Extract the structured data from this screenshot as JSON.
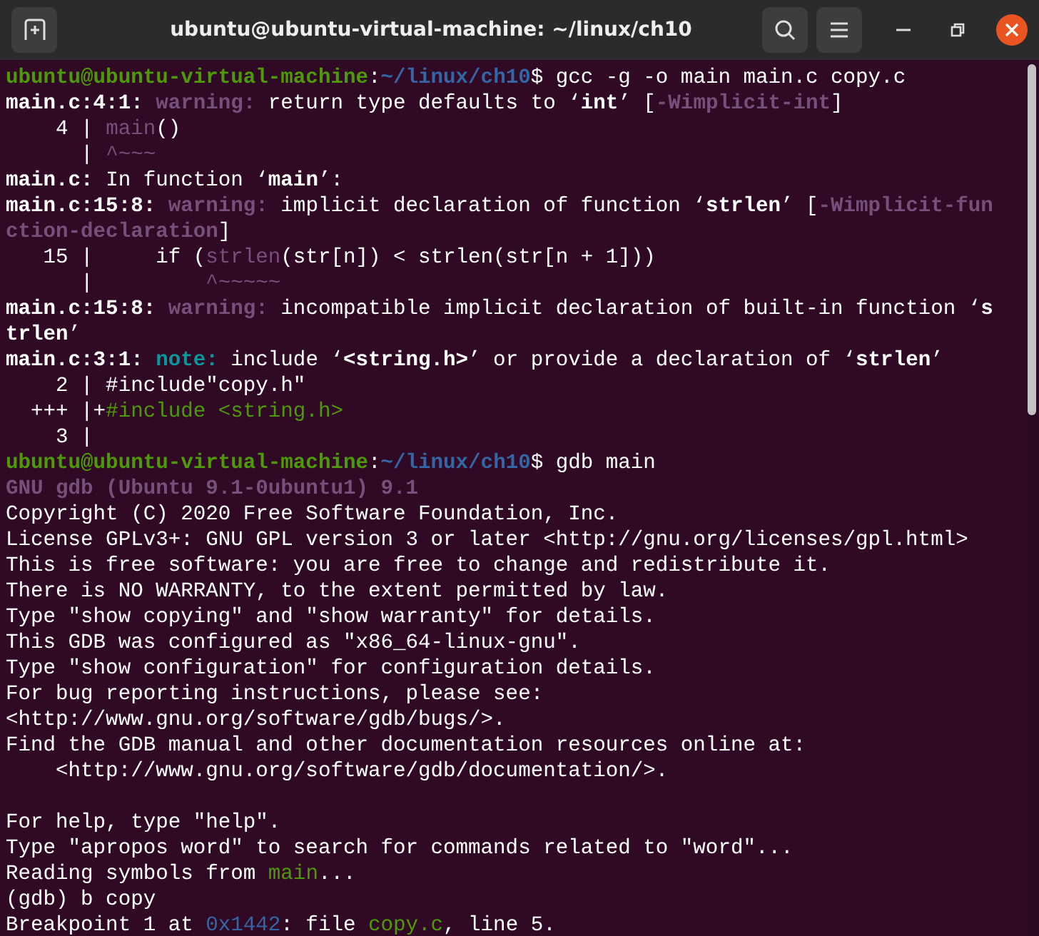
{
  "window": {
    "title": "ubuntu@ubuntu-virtual-machine: ~/linux/ch10"
  },
  "terminal": {
    "lines": [
      {
        "kind": "text",
        "segments": [
          {
            "text": "ubuntu@ubuntu-virtual-machine",
            "kind": "user"
          },
          {
            "text": ":",
            "kind": "plain"
          },
          {
            "text": "~/linux/ch10",
            "kind": "path"
          },
          {
            "text": "$ gcc -g -o main main.c copy.c",
            "kind": "plain"
          }
        ]
      },
      {
        "kind": "text",
        "segments": [
          {
            "text": "main.c:4:1: ",
            "kind": "bold"
          },
          {
            "text": "warning:",
            "kind": "warning"
          },
          {
            "text": " return type defaults to ‘",
            "kind": "plain"
          },
          {
            "text": "int",
            "kind": "bold"
          },
          {
            "text": "’ [",
            "kind": "plain"
          },
          {
            "text": "-Wimplicit-int",
            "kind": "warning"
          },
          {
            "text": "]",
            "kind": "plain"
          }
        ]
      },
      {
        "kind": "text",
        "segments": [
          {
            "text": "    4 | ",
            "kind": "plain"
          },
          {
            "text": "main",
            "kind": "purple"
          },
          {
            "text": "()",
            "kind": "plain"
          }
        ]
      },
      {
        "kind": "text",
        "segments": [
          {
            "text": "      | ",
            "kind": "plain"
          },
          {
            "text": "^~~~",
            "kind": "purple"
          }
        ]
      },
      {
        "kind": "text",
        "segments": [
          {
            "text": "main.c:",
            "kind": "bold"
          },
          {
            "text": " In function ‘",
            "kind": "plain"
          },
          {
            "text": "main",
            "kind": "bold"
          },
          {
            "text": "’:",
            "kind": "plain"
          }
        ]
      },
      {
        "kind": "text",
        "segments": [
          {
            "text": "main.c:15:8: ",
            "kind": "bold"
          },
          {
            "text": "warning:",
            "kind": "warning"
          },
          {
            "text": " implicit declaration of function ‘",
            "kind": "plain"
          },
          {
            "text": "strlen",
            "kind": "bold"
          },
          {
            "text": "’ [",
            "kind": "plain"
          },
          {
            "text": "-Wimplicit-fun",
            "kind": "warning"
          }
        ]
      },
      {
        "kind": "text",
        "segments": [
          {
            "text": "ction-declaration",
            "kind": "warning"
          },
          {
            "text": "]",
            "kind": "plain"
          }
        ]
      },
      {
        "kind": "text",
        "segments": [
          {
            "text": "   15 |     if (",
            "kind": "plain"
          },
          {
            "text": "strlen",
            "kind": "purple"
          },
          {
            "text": "(str[n]) < strlen(str[n + 1]))",
            "kind": "plain"
          }
        ]
      },
      {
        "kind": "text",
        "segments": [
          {
            "text": "      |         ",
            "kind": "plain"
          },
          {
            "text": "^~~~~~",
            "kind": "purple"
          }
        ]
      },
      {
        "kind": "text",
        "segments": [
          {
            "text": "main.c:15:8: ",
            "kind": "bold"
          },
          {
            "text": "warning:",
            "kind": "warning"
          },
          {
            "text": " incompatible implicit declaration of built-in function ‘",
            "kind": "plain"
          },
          {
            "text": "s",
            "kind": "bold"
          }
        ]
      },
      {
        "kind": "text",
        "segments": [
          {
            "text": "trlen",
            "kind": "bold"
          },
          {
            "text": "’",
            "kind": "plain"
          }
        ]
      },
      {
        "kind": "text",
        "segments": [
          {
            "text": "main.c:3:1: ",
            "kind": "bold"
          },
          {
            "text": "note:",
            "kind": "note"
          },
          {
            "text": " include ‘",
            "kind": "plain"
          },
          {
            "text": "<string.h>",
            "kind": "bold"
          },
          {
            "text": "’ or provide a declaration of ‘",
            "kind": "plain"
          },
          {
            "text": "strlen",
            "kind": "bold"
          },
          {
            "text": "’",
            "kind": "plain"
          }
        ]
      },
      {
        "kind": "text",
        "segments": [
          {
            "text": "    2 | #include\"copy.h\"",
            "kind": "plain"
          }
        ]
      },
      {
        "kind": "text",
        "segments": [
          {
            "text": "  +++ |+",
            "kind": "plain"
          },
          {
            "text": "#include <string.h>",
            "kind": "green"
          }
        ]
      },
      {
        "kind": "text",
        "segments": [
          {
            "text": "    3 |",
            "kind": "plain"
          }
        ]
      },
      {
        "kind": "text",
        "segments": [
          {
            "text": "ubuntu@ubuntu-virtual-machine",
            "kind": "user"
          },
          {
            "text": ":",
            "kind": "plain"
          },
          {
            "text": "~/linux/ch10",
            "kind": "path"
          },
          {
            "text": "$ gdb main",
            "kind": "plain"
          }
        ]
      },
      {
        "kind": "text",
        "segments": [
          {
            "text": "GNU gdb (Ubuntu 9.1-0ubuntu1) 9.1",
            "kind": "heading"
          }
        ]
      },
      {
        "kind": "text",
        "segments": [
          {
            "text": "Copyright (C) 2020 Free Software Foundation, Inc.",
            "kind": "plain"
          }
        ]
      },
      {
        "kind": "text",
        "segments": [
          {
            "text": "License GPLv3+: GNU GPL version 3 or later <http://gnu.org/licenses/gpl.html>",
            "kind": "plain"
          }
        ]
      },
      {
        "kind": "text",
        "segments": [
          {
            "text": "This is free software: you are free to change and redistribute it.",
            "kind": "plain"
          }
        ]
      },
      {
        "kind": "text",
        "segments": [
          {
            "text": "There is NO WARRANTY, to the extent permitted by law.",
            "kind": "plain"
          }
        ]
      },
      {
        "kind": "text",
        "segments": [
          {
            "text": "Type \"show copying\" and \"show warranty\" for details.",
            "kind": "plain"
          }
        ]
      },
      {
        "kind": "text",
        "segments": [
          {
            "text": "This GDB was configured as \"x86_64-linux-gnu\".",
            "kind": "plain"
          }
        ]
      },
      {
        "kind": "text",
        "segments": [
          {
            "text": "Type \"show configuration\" for configuration details.",
            "kind": "plain"
          }
        ]
      },
      {
        "kind": "text",
        "segments": [
          {
            "text": "For bug reporting instructions, please see:",
            "kind": "plain"
          }
        ]
      },
      {
        "kind": "text",
        "segments": [
          {
            "text": "<http://www.gnu.org/software/gdb/bugs/>.",
            "kind": "plain"
          }
        ]
      },
      {
        "kind": "text",
        "segments": [
          {
            "text": "Find the GDB manual and other documentation resources online at:",
            "kind": "plain"
          }
        ]
      },
      {
        "kind": "text",
        "segments": [
          {
            "text": "    <http://www.gnu.org/software/gdb/documentation/>.",
            "kind": "plain"
          }
        ]
      },
      {
        "kind": "blank"
      },
      {
        "kind": "text",
        "segments": [
          {
            "text": "For help, type \"help\".",
            "kind": "plain"
          }
        ]
      },
      {
        "kind": "text",
        "segments": [
          {
            "text": "Type \"apropos word\" to search for commands related to \"word\"...",
            "kind": "plain"
          }
        ]
      },
      {
        "kind": "text",
        "segments": [
          {
            "text": "Reading symbols from ",
            "kind": "plain"
          },
          {
            "text": "main",
            "kind": "green"
          },
          {
            "text": "...",
            "kind": "plain"
          }
        ]
      },
      {
        "kind": "text",
        "segments": [
          {
            "text": "(gdb) b copy",
            "kind": "plain"
          }
        ]
      },
      {
        "kind": "text",
        "segments": [
          {
            "text": "Breakpoint 1 at ",
            "kind": "plain"
          },
          {
            "text": "0x1442",
            "kind": "blue"
          },
          {
            "text": ": file ",
            "kind": "plain"
          },
          {
            "text": "copy.c",
            "kind": "green"
          },
          {
            "text": ", line 5.",
            "kind": "plain"
          }
        ]
      }
    ]
  }
}
